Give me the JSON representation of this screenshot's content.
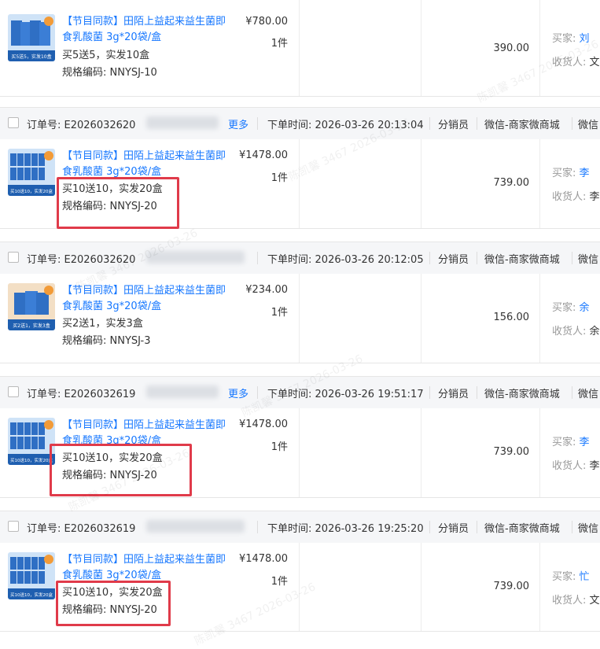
{
  "labels": {
    "order_no": "订单号:",
    "order_time": "下单时间:",
    "distributor": "分销员",
    "channel": "微信-商家微商城",
    "channel_trunc": "微信",
    "more": "更多",
    "buyer": "买家:",
    "receiver": "收货人:"
  },
  "watermark": "陈凯馨 3467 2026-03-26",
  "orders": [
    {
      "header": null,
      "thumb_badge": "买5送5，实发10盒",
      "title": "【节目同款】田陌上益起来益生菌即食乳酸菌 3g*20袋/盒",
      "spec_line1": "买5送5，实发10盒",
      "spec_line2": "规格编码: NNYSJ-10",
      "price": "¥780.00",
      "qty": "1件",
      "amount": "390.00",
      "buyer": "刘",
      "receiver": "文"
    },
    {
      "header": {
        "order_no": "E2026032620",
        "time": "2026-03-26 20:13:04"
      },
      "thumb_badge": "买10送10，实发20盒",
      "title": "【节目同款】田陌上益起来益生菌即食乳酸菌 3g*20袋/盒",
      "spec_line1": "买10送10，实发20盒",
      "spec_line2": "规格编码: NNYSJ-20",
      "price": "¥1478.00",
      "qty": "1件",
      "amount": "739.00",
      "buyer": "李",
      "receiver": "李"
    },
    {
      "header": {
        "order_no": "E2026032620",
        "time": "2026-03-26 20:12:05"
      },
      "thumb_badge": "买2送1，实发3盒",
      "title": "【节目同款】田陌上益起来益生菌即食乳酸菌 3g*20袋/盒",
      "spec_line1": "买2送1，实发3盒",
      "spec_line2": "规格编码: NNYSJ-3",
      "price": "¥234.00",
      "qty": "1件",
      "amount": "156.00",
      "buyer": "余",
      "receiver": "余"
    },
    {
      "header": {
        "order_no": "E2026032619",
        "time": "2026-03-26 19:51:17"
      },
      "thumb_badge": "买10送10，实发20盒",
      "title": "【节目同款】田陌上益起来益生菌即食乳酸菌 3g*20袋/盒",
      "spec_line1": "买10送10，实发20盒",
      "spec_line2": "规格编码: NNYSJ-20",
      "price": "¥1478.00",
      "qty": "1件",
      "amount": "739.00",
      "buyer": "李",
      "receiver": "李"
    },
    {
      "header": {
        "order_no": "E2026032619",
        "time": "2026-03-26 19:25:20"
      },
      "thumb_badge": "买10送10，实发20盒",
      "title": "【节目同款】田陌上益起来益生菌即食乳酸菌 3g*20袋/盒",
      "spec_line1": "买10送10，实发20盒",
      "spec_line2": "规格编码: NNYSJ-20",
      "price": "¥1478.00",
      "qty": "1件",
      "amount": "739.00",
      "buyer": "忙",
      "receiver": "文"
    }
  ],
  "colors": {
    "link": "#1677ff",
    "highlight": "#e03b4a"
  }
}
